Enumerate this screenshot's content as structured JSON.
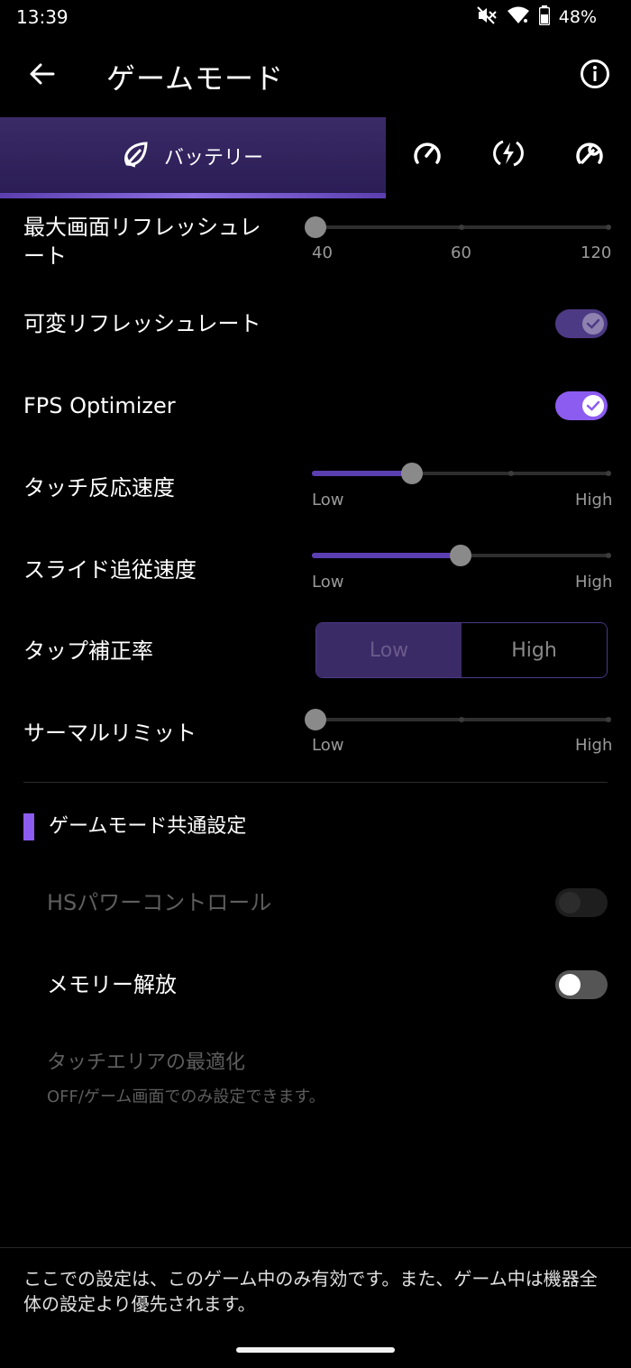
{
  "status_bar": {
    "time": "13:39",
    "battery_percent": "48%",
    "icons": [
      "mute-icon",
      "wifi-icon",
      "battery-icon"
    ]
  },
  "app_bar": {
    "title": "ゲームモード",
    "back_icon": "arrow-left-icon",
    "info_icon": "info-icon"
  },
  "tabs": {
    "active_label": "バッテリー",
    "items": [
      {
        "icon": "leaf-battery-icon",
        "label": "バッテリー",
        "active": true
      },
      {
        "icon": "speedometer-icon",
        "active": false
      },
      {
        "icon": "lightning-icon",
        "active": false
      },
      {
        "icon": "wrench-icon",
        "active": false
      }
    ]
  },
  "settings": {
    "max_refresh": {
      "label_line1": "最大画面リフレッシュレ",
      "label_line2": "ート",
      "ticks": [
        "40",
        "60",
        "120"
      ],
      "value": "40"
    },
    "variable_refresh": {
      "label": "可変リフレッシュレート",
      "enabled": true
    },
    "fps_optimizer": {
      "label": "FPS Optimizer",
      "enabled": true
    },
    "touch_response": {
      "label": "タッチ反応速度",
      "low": "Low",
      "high": "High",
      "level": 1
    },
    "slide_follow": {
      "label": "スライド追従速度",
      "low": "Low",
      "high": "High",
      "level": 2
    },
    "tap_correction": {
      "label": "タップ補正率",
      "options": [
        "Low",
        "High"
      ],
      "selected": "Low"
    },
    "thermal_limit": {
      "label": "サーマルリミット",
      "low": "Low",
      "high": "High",
      "level": 0
    }
  },
  "common_section": {
    "title": "ゲームモード共通設定",
    "hs_power": {
      "label": "HSパワーコントロール",
      "enabled": false,
      "disabled": true
    },
    "memory_release": {
      "label": "メモリー解放",
      "enabled": false
    },
    "touch_area": {
      "label": "タッチエリアの最適化",
      "hint": "OFF/ゲーム画面でのみ設定できます。"
    }
  },
  "footer": {
    "text": "ここでの設定は、このゲーム中のみ有効です。また、ゲーム中は機器全体の設定より優先されます。"
  },
  "colors": {
    "accent": "#8c5cf0",
    "tab_bg": "#2a1c55",
    "background": "#000000"
  }
}
